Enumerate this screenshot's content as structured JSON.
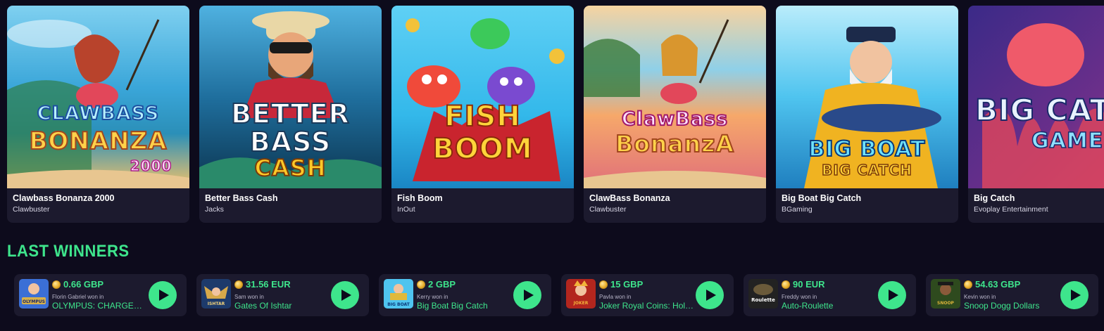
{
  "games": [
    {
      "name": "Clawbass Bonanza 2000",
      "provider": "Clawbuster",
      "thumb_text": [
        "CLAWBASS",
        "BONANZA",
        "2000"
      ],
      "colors": [
        "#3aa6d9",
        "#f4c36a"
      ]
    },
    {
      "name": "Better Bass Cash",
      "provider": "Jacks",
      "thumb_text": [
        "BETTER",
        "BASS",
        "CASH"
      ],
      "colors": [
        "#1f6f9e",
        "#0c3550"
      ]
    },
    {
      "name": "Fish Boom",
      "provider": "InOut",
      "thumb_text": [
        "FISH",
        "BOOM"
      ],
      "colors": [
        "#33b8ea",
        "#1a86c4"
      ]
    },
    {
      "name": "ClawBass Bonanza",
      "provider": "Clawbuster",
      "thumb_text": [
        "ClawBass",
        "BonanzA"
      ],
      "colors": [
        "#f6a86a",
        "#e06f7a"
      ]
    },
    {
      "name": "Big Boat Big Catch",
      "provider": "BGaming",
      "thumb_text": [
        "BIG BOAT",
        "BIG CATCH"
      ],
      "colors": [
        "#4fc4ef",
        "#1f7fbf"
      ]
    },
    {
      "name": "Big Catch",
      "provider": "Evoplay Entertainment",
      "thumb_text": [
        "BIG CATC",
        "GAME"
      ],
      "colors": [
        "#3b2a88",
        "#c0437a"
      ]
    }
  ],
  "last_winners": {
    "title": "LAST WINNERS",
    "items": [
      {
        "amount": "0.66 GBP",
        "who": "Florin Gabriel won in",
        "game": "OLYMPUS: CHARGED UP",
        "thumb_label": "OLYMPUS",
        "colors": [
          "#3b6fd6",
          "#d8b14a"
        ]
      },
      {
        "amount": "31.56 EUR",
        "who": "Sam won in",
        "game": "Gates Of Ishtar",
        "thumb_label": "ISHTAR",
        "colors": [
          "#1d3a6b",
          "#d6a84a"
        ]
      },
      {
        "amount": "2 GBP",
        "who": "Kerry won in",
        "game": "Big Boat Big Catch",
        "thumb_label": "BIG BOAT",
        "colors": [
          "#4fc4ef",
          "#e0b93a"
        ]
      },
      {
        "amount": "15 GBP",
        "who": "Pavla won in",
        "game": "Joker Royal Coins: Hold & Win",
        "thumb_label": "JOKER",
        "colors": [
          "#b3261e",
          "#f2b33a"
        ]
      },
      {
        "amount": "90 EUR",
        "who": "Freddy won in",
        "game": "Auto-Roulette",
        "thumb_label": "Roulette",
        "colors": [
          "#222222",
          "#6a5a3a"
        ]
      },
      {
        "amount": "54.63 GBP",
        "who": "Kevin won in",
        "game": "Snoop Dogg Dollars",
        "thumb_label": "SNOOP",
        "colors": [
          "#2e4a1e",
          "#d9b13a"
        ]
      }
    ]
  }
}
